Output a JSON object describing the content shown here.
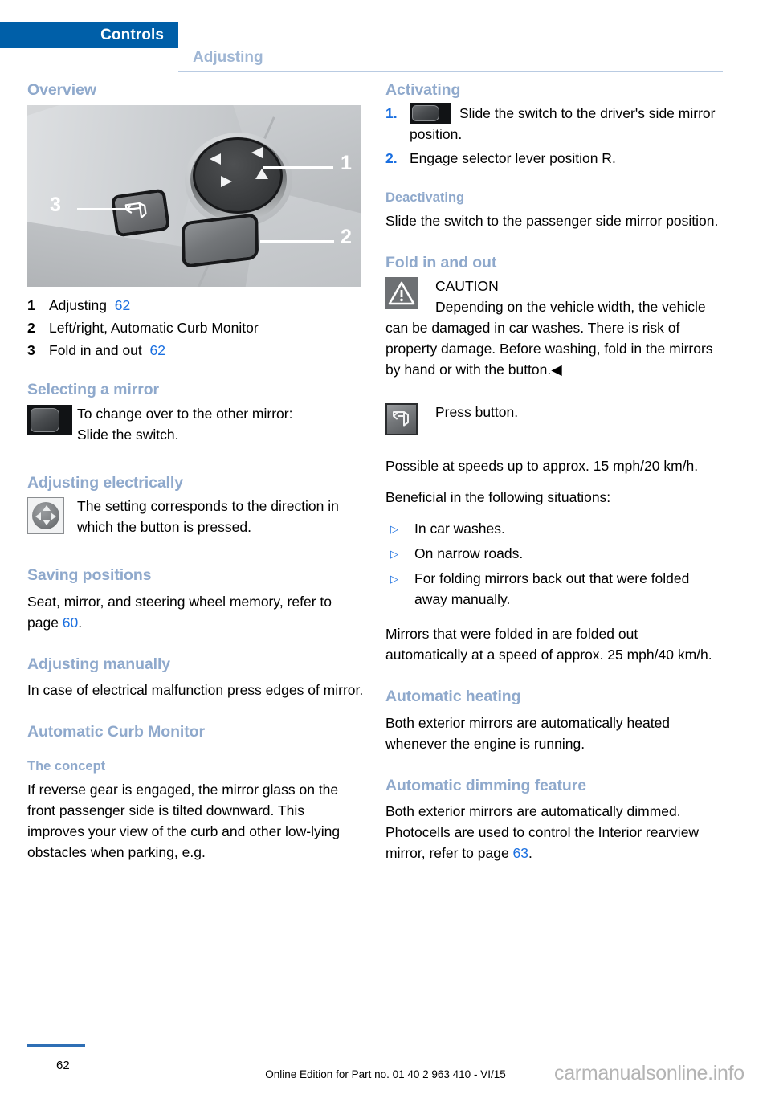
{
  "header": {
    "active_tab": "Controls",
    "secondary_tab": "Adjusting"
  },
  "left_column": {
    "overview": {
      "heading": "Overview",
      "figure": {
        "callouts": [
          "1",
          "2",
          "3"
        ],
        "alt": "Exterior mirror control cluster with joystick, rocker switch and fold button"
      },
      "legend": [
        {
          "num": "1",
          "text": "Adjusting",
          "page": "62"
        },
        {
          "num": "2",
          "text": "Left/right, Automatic Curb Monitor",
          "page": ""
        },
        {
          "num": "3",
          "text": "Fold in and out",
          "page": "62"
        }
      ]
    },
    "selecting_a_mirror": {
      "heading": "Selecting a mirror",
      "icon": "mirror-select-switch-icon",
      "line1": "To change over to the other mirror:",
      "line2": "Slide the switch."
    },
    "adjusting_electrically": {
      "heading": "Adjusting electrically",
      "icon": "joystick-icon",
      "text": "The setting corresponds to the direction in which the button is pressed."
    },
    "saving_positions": {
      "heading": "Saving positions",
      "text_before": "Seat, mirror, and steering wheel memory, refer to page ",
      "page": "60",
      "text_after": "."
    },
    "adjusting_manually": {
      "heading": "Adjusting manually",
      "text": "In case of electrical malfunction press edges of mirror."
    },
    "automatic_curb_monitor": {
      "heading": "Automatic Curb Monitor",
      "sub_heading": "The concept",
      "text": "If reverse gear is engaged, the mirror glass on the front passenger side is tilted downward. This improves your view of the curb and other low-lying obstacles when parking, e.g."
    }
  },
  "right_column": {
    "activating": {
      "heading": "Activating",
      "steps": [
        {
          "num": "1.",
          "icon": "mirror-select-switch-icon",
          "text": "Slide the switch to the driver's side mirror position."
        },
        {
          "num": "2.",
          "icon": "",
          "text": "Engage selector lever position R."
        }
      ]
    },
    "deactivating": {
      "heading": "Deactivating",
      "text": "Slide the switch to the passenger side mirror position."
    },
    "fold_in_and_out": {
      "heading": "Fold in and out",
      "caution": {
        "icon": "warning-triangle-icon",
        "title": "CAUTION",
        "text": "Depending on the vehicle width, the vehicle can be damaged in car washes. There is risk of property damage. Before washing, fold in the mirrors by hand or with the button.◀"
      },
      "press_button": {
        "icon": "fold-mirror-button-icon",
        "text": "Press button."
      },
      "speed_note": "Possible at speeds up to approx. 15 mph/20 km/h.",
      "beneficial_intro": "Beneficial in the following situations:",
      "bullets": [
        "In car washes.",
        "On narrow roads.",
        "For folding mirrors back out that were folded away manually."
      ],
      "auto_unfold_note": "Mirrors that were folded in are folded out automatically at a speed of approx. 25 mph/40 km/h."
    },
    "automatic_heating": {
      "heading": "Automatic heating",
      "text": "Both exterior mirrors are automatically heated whenever the engine is running."
    },
    "automatic_dimming": {
      "heading": "Automatic dimming feature",
      "text_before": "Both exterior mirrors are automatically dimmed. Photocells are used to control the Interior rearview mirror, refer to page ",
      "page": "63",
      "text_after": "."
    }
  },
  "footer": {
    "page_number": "62",
    "edition": "Online Edition for Part no. 01 40 2 963 410 - VI/15",
    "watermark": "carmanualsonline.info"
  },
  "colors": {
    "header_blue": "#005fa8",
    "heading_blue": "#8fa9cc",
    "link_blue": "#1a6fe0",
    "secondary_tab": "#9fb6d4"
  }
}
